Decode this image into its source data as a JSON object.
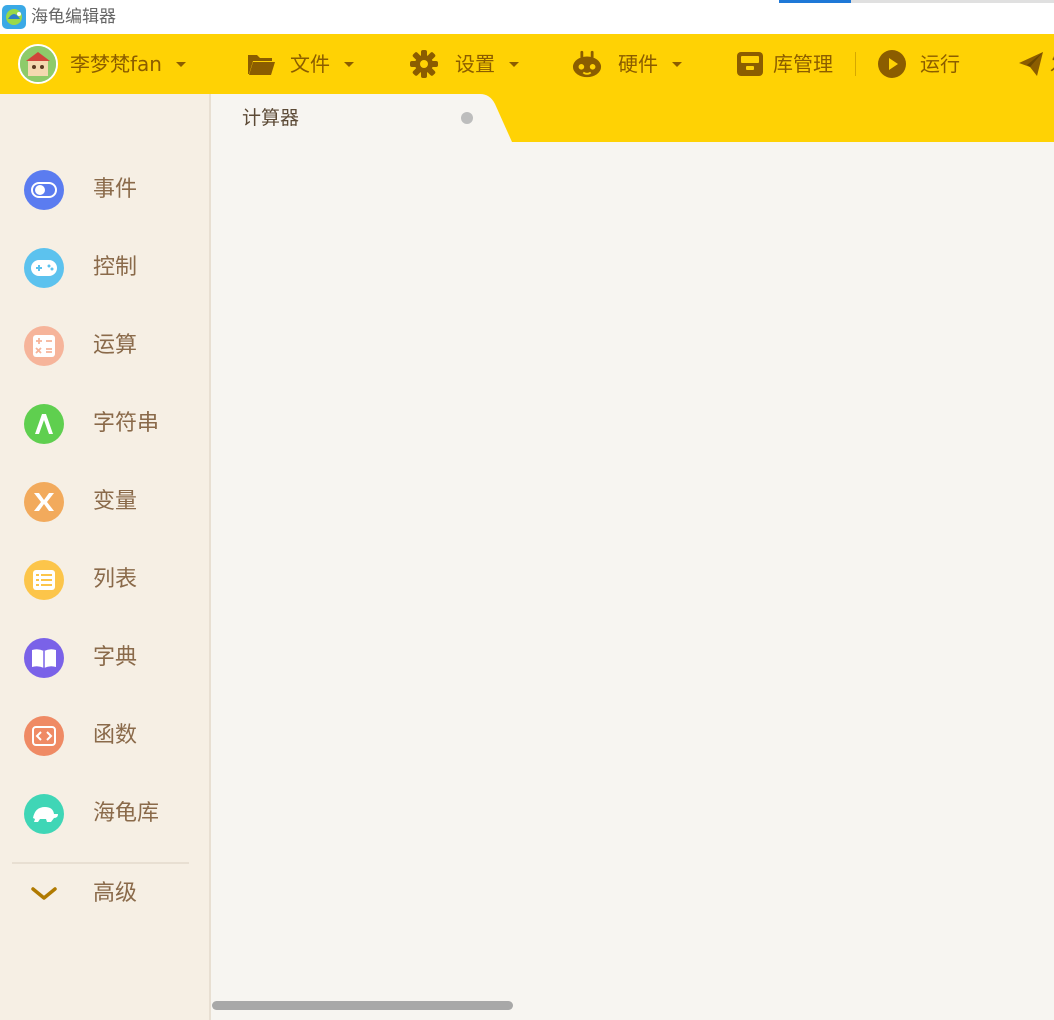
{
  "window": {
    "title": "海龟编辑器"
  },
  "toolbar": {
    "user_name": "李梦梵fan",
    "file_label": "文件",
    "settings_label": "设置",
    "hardware_label": "硬件",
    "library_label": "库管理",
    "run_label": "运行",
    "publish_label": "发"
  },
  "tabs": [
    {
      "label": "计算器",
      "unsaved": true
    }
  ],
  "sidebar": {
    "categories": [
      {
        "label": "事件",
        "icon": "toggle-icon",
        "color": "#5b7cf0"
      },
      {
        "label": "控制",
        "icon": "gamepad-icon",
        "color": "#5cc2ee"
      },
      {
        "label": "运算",
        "icon": "calculator-icon",
        "color": "#f6b49a"
      },
      {
        "label": "字符串",
        "icon": "letter-a-icon",
        "color": "#5fcf4f"
      },
      {
        "label": "变量",
        "icon": "variable-x-icon",
        "color": "#f2aa5c"
      },
      {
        "label": "列表",
        "icon": "list-icon",
        "color": "#fcc54a"
      },
      {
        "label": "字典",
        "icon": "book-icon",
        "color": "#7a62e8"
      },
      {
        "label": "函数",
        "icon": "code-icon",
        "color": "#ef8a64"
      },
      {
        "label": "海龟库",
        "icon": "turtle-icon",
        "color": "#3fd6b6"
      }
    ],
    "advanced_label": "高级"
  },
  "colors": {
    "toolbar_bg": "#ffd204",
    "toolbar_text": "#8b5d00",
    "sidebar_bg": "#f6efe4",
    "workspace_bg": "#f7f5f1"
  }
}
